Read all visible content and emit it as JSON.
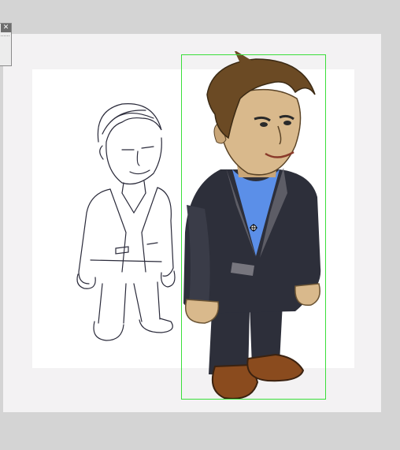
{
  "panel": {
    "close_glyph": "✕",
    "close_icon": "close-icon"
  },
  "selection": {
    "color": "#3adf3a"
  },
  "colors": {
    "workspace": "#d4d4d4",
    "page": "#f3f2f3",
    "artboard": "#ffffff",
    "suit": "#2d2f3a",
    "shirt": "#5b8fe8",
    "hair": "#6b4a24",
    "skin": "#d9b98c",
    "shoes": "#8a4b1e"
  },
  "icons": {
    "transform_center": "crosshair-icon"
  }
}
